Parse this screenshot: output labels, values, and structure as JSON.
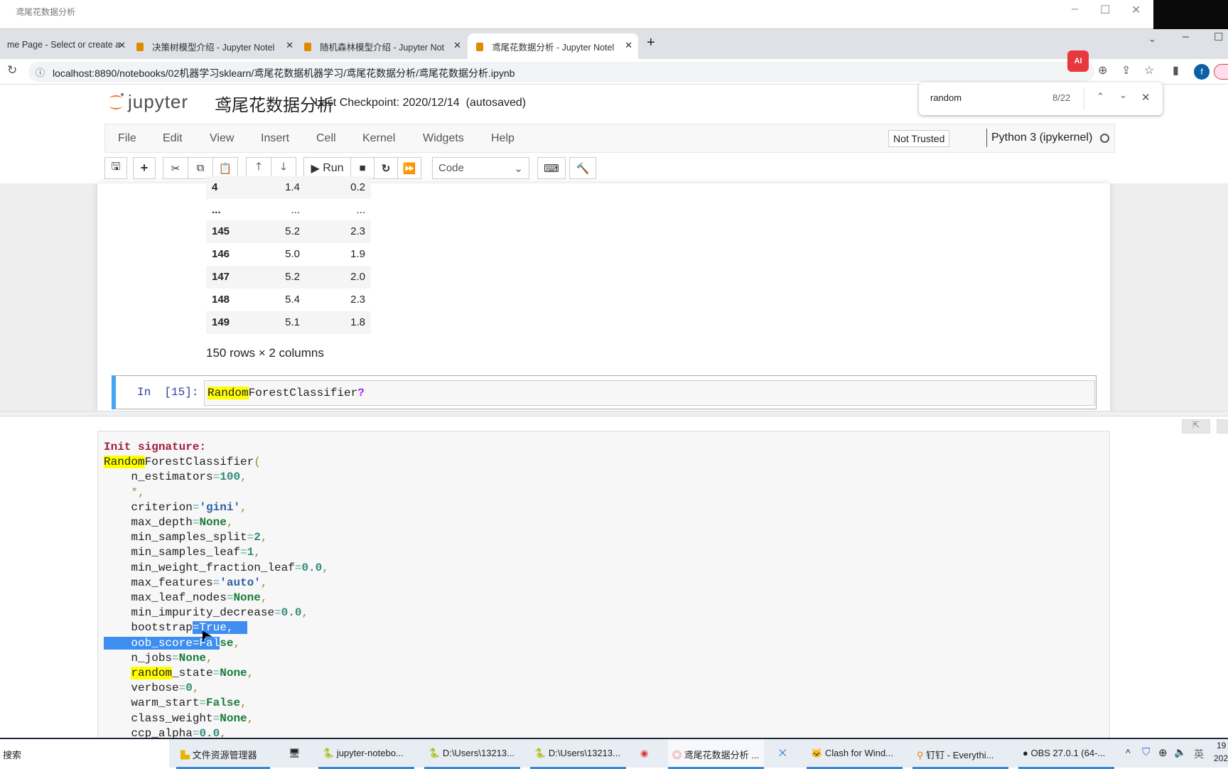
{
  "os_window": {
    "title": "鸢尾花数据分析"
  },
  "tabs": [
    {
      "label": "me Page - Select or create a"
    },
    {
      "label": "决策树模型介绍 - Jupyter Notel"
    },
    {
      "label": "随机森林模型介绍 - Jupyter Not"
    },
    {
      "label": "鸢尾花数据分析 - Jupyter Notel"
    }
  ],
  "address": {
    "url": "localhost:8890/notebooks/02机器学习sklearn/鸢尾花数据机器学习/鸢尾花数据分析/鸢尾花数据分析.ipynb"
  },
  "find": {
    "query": "random",
    "count": "8/22"
  },
  "jupyter": {
    "logo": "jupyter",
    "title": "鸢尾花数据分析",
    "checkpoint": "Last Checkpoint: 2020/12/14  (autosaved)",
    "trust": "Not Trusted",
    "kernel": "Python 3 (ipykernel)"
  },
  "menu": [
    "File",
    "Edit",
    "View",
    "Insert",
    "Cell",
    "Kernel",
    "Widgets",
    "Help"
  ],
  "toolbar": {
    "run": "Run",
    "celltype": "Code"
  },
  "table": {
    "rows": [
      {
        "idx": "4",
        "c1": "1.4",
        "c2": "0.2"
      },
      {
        "idx": "...",
        "c1": "...",
        "c2": "..."
      },
      {
        "idx": "145",
        "c1": "5.2",
        "c2": "2.3"
      },
      {
        "idx": "146",
        "c1": "5.0",
        "c2": "1.9"
      },
      {
        "idx": "147",
        "c1": "5.2",
        "c2": "2.0"
      },
      {
        "idx": "148",
        "c1": "5.4",
        "c2": "2.3"
      },
      {
        "idx": "149",
        "c1": "5.1",
        "c2": "1.8"
      }
    ],
    "summary": "150 rows × 2 columns"
  },
  "cell": {
    "prompt": "In  [15]:",
    "code_hl": "Random",
    "code_rest": "ForestClassifier",
    "code_q": "?"
  },
  "pager": {
    "lines": [
      [
        [
          "Init signature:",
          "kw"
        ]
      ],
      [
        [
          "Random",
          "hl"
        ],
        [
          "ForestClassifier",
          ""
        ],
        [
          "(",
          "punc"
        ]
      ],
      [
        [
          "    n_estimators",
          ""
        ],
        [
          "=",
          "eq"
        ],
        [
          "100",
          "num"
        ],
        [
          ",",
          "punc"
        ]
      ],
      [
        [
          "    ",
          ""
        ],
        [
          "*",
          "punc"
        ],
        [
          ",",
          "punc"
        ]
      ],
      [
        [
          "    criterion",
          ""
        ],
        [
          "=",
          "eq"
        ],
        [
          "'gini'",
          "str"
        ],
        [
          ",",
          "punc"
        ]
      ],
      [
        [
          "    max_depth",
          ""
        ],
        [
          "=",
          "eq"
        ],
        [
          "None",
          "const"
        ],
        [
          ",",
          "punc"
        ]
      ],
      [
        [
          "    min_samples_split",
          ""
        ],
        [
          "=",
          "eq"
        ],
        [
          "2",
          "num"
        ],
        [
          ",",
          "punc"
        ]
      ],
      [
        [
          "    min_samples_leaf",
          ""
        ],
        [
          "=",
          "eq"
        ],
        [
          "1",
          "num"
        ],
        [
          ",",
          "punc"
        ]
      ],
      [
        [
          "    min_weight_fraction_leaf",
          ""
        ],
        [
          "=",
          "eq"
        ],
        [
          "0.0",
          "num"
        ],
        [
          ",",
          "punc"
        ]
      ],
      [
        [
          "    max_features",
          ""
        ],
        [
          "=",
          "eq"
        ],
        [
          "'auto'",
          "str"
        ],
        [
          ",",
          "punc"
        ]
      ],
      [
        [
          "    max_leaf_nodes",
          ""
        ],
        [
          "=",
          "eq"
        ],
        [
          "None",
          "const"
        ],
        [
          ",",
          "punc"
        ]
      ],
      [
        [
          "    min_impurity_decrease",
          ""
        ],
        [
          "=",
          "eq"
        ],
        [
          "0.0",
          "num"
        ],
        [
          ",",
          "punc"
        ]
      ],
      [
        [
          "    bootstrap",
          ""
        ],
        [
          "=True,  ",
          "sel"
        ]
      ],
      [
        [
          "    oob_score=Fal",
          "sel"
        ],
        [
          "se",
          "const"
        ],
        [
          ",",
          "punc"
        ]
      ],
      [
        [
          "    n_jobs",
          ""
        ],
        [
          "=",
          "eq"
        ],
        [
          "None",
          "const"
        ],
        [
          ",",
          "punc"
        ]
      ],
      [
        [
          "    ",
          ""
        ],
        [
          "random",
          "hl"
        ],
        [
          "_state",
          ""
        ],
        [
          "=",
          "eq"
        ],
        [
          "None",
          "const"
        ],
        [
          ",",
          "punc"
        ]
      ],
      [
        [
          "    verbose",
          ""
        ],
        [
          "=",
          "eq"
        ],
        [
          "0",
          "num"
        ],
        [
          ",",
          "punc"
        ]
      ],
      [
        [
          "    warm_start",
          ""
        ],
        [
          "=",
          "eq"
        ],
        [
          "False",
          "const"
        ],
        [
          ",",
          "punc"
        ]
      ],
      [
        [
          "    class_weight",
          ""
        ],
        [
          "=",
          "eq"
        ],
        [
          "None",
          "const"
        ],
        [
          ",",
          "punc"
        ]
      ],
      [
        [
          "    ccp_alpha",
          ""
        ],
        [
          "=",
          "eq"
        ],
        [
          "0.0",
          "num"
        ],
        [
          ",",
          "punc"
        ]
      ]
    ]
  },
  "taskbar": {
    "search": "搜索",
    "items": [
      "文件资源管理器",
      "jupyter-notebo...",
      "D:\\Users\\13213...",
      "D:\\Users\\13213...",
      "鸢尾花数据分析 ...",
      "Clash for Wind...",
      "钉钉 - Everythi...",
      "OBS 27.0.1 (64-..."
    ],
    "ime": "英",
    "clock_time": "19",
    "clock_date": "202"
  }
}
